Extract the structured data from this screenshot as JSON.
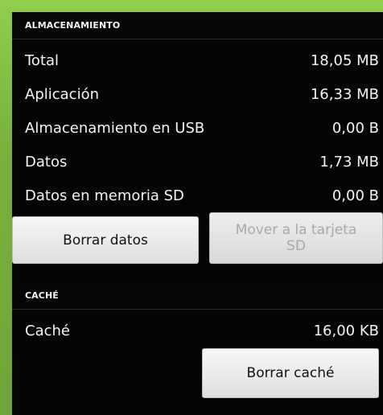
{
  "storage_section": {
    "title": "ALMACENAMIENTO",
    "rows": [
      {
        "label": "Total",
        "value": "18,05 MB"
      },
      {
        "label": "Aplicación",
        "value": "16,33 MB"
      },
      {
        "label": "Almacenamiento en USB",
        "value": "0,00 B"
      },
      {
        "label": "Datos",
        "value": "1,73 MB"
      },
      {
        "label": "Datos en memoria SD",
        "value": "0,00 B"
      }
    ],
    "clear_data_label": "Borrar datos",
    "move_to_sd_label_line1": "Mover a la tarjeta",
    "move_to_sd_label_line2": "SD"
  },
  "cache_section": {
    "title": "CACHÉ",
    "row": {
      "label": "Caché",
      "value": "16,00 KB"
    },
    "clear_cache_label": "Borrar caché"
  }
}
